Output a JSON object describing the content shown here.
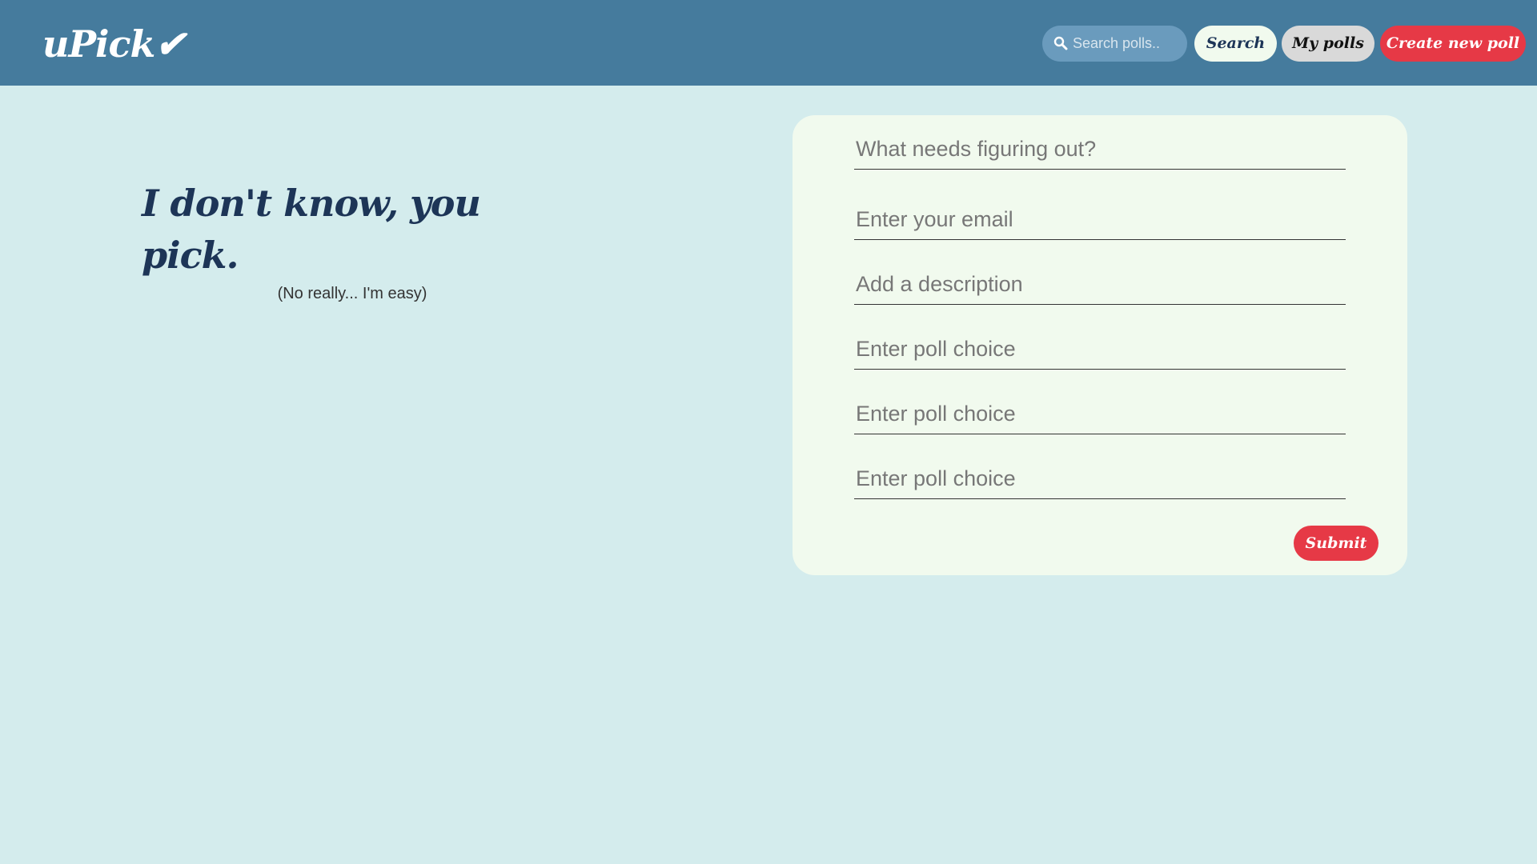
{
  "header": {
    "logo_text": "uPick✔",
    "search": {
      "placeholder": "Search polls..",
      "value": "",
      "icon": "search-icon"
    },
    "search_button_label": "Search",
    "my_polls_label": "My polls",
    "create_poll_label": "Create new poll"
  },
  "hero": {
    "title": "I don't know, you pick.",
    "subtitle": "(No really... I'm easy)"
  },
  "form": {
    "question_placeholder": "What needs figuring out?",
    "email_placeholder": "Enter your email",
    "description_placeholder": "Add a description",
    "choices": [
      {
        "placeholder": "Enter poll choice",
        "value": ""
      },
      {
        "placeholder": "Enter poll choice",
        "value": ""
      },
      {
        "placeholder": "Enter poll choice",
        "value": ""
      }
    ],
    "submit_label": "Submit"
  },
  "colors": {
    "navbar": "#457b9d",
    "background": "#d4eced",
    "card": "#f1faee",
    "accent_red": "#e63946",
    "text_navy": "#1d3557"
  }
}
